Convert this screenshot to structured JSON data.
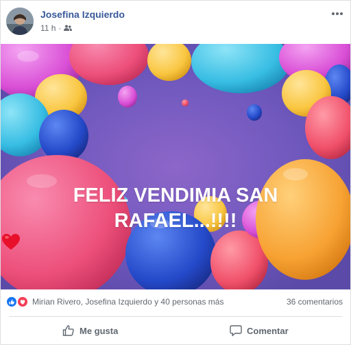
{
  "post": {
    "author": "Josefina Izquierdo",
    "time": "11 h",
    "separator": "·",
    "image_text_line1": "FELIZ VENDIMIA SAN",
    "image_text_line2": "RAFAEL...!!!!"
  },
  "reactions": {
    "names": "Mirian Rivero, Josefina Izquierdo y 40 personas más",
    "comments": "36 comentarios"
  },
  "actions": {
    "like_label": "Me gusta",
    "comment_label": "Comentar"
  },
  "colors": {
    "author_link": "#385898",
    "secondary_text": "#616770",
    "like_blue": "#1877f2",
    "love_red": "#f33e58"
  },
  "icons": [
    "more-icon",
    "friends-icon",
    "like-reaction-icon",
    "love-reaction-icon",
    "thumbs-up-icon",
    "comment-icon",
    "heart-emoji-icon"
  ]
}
